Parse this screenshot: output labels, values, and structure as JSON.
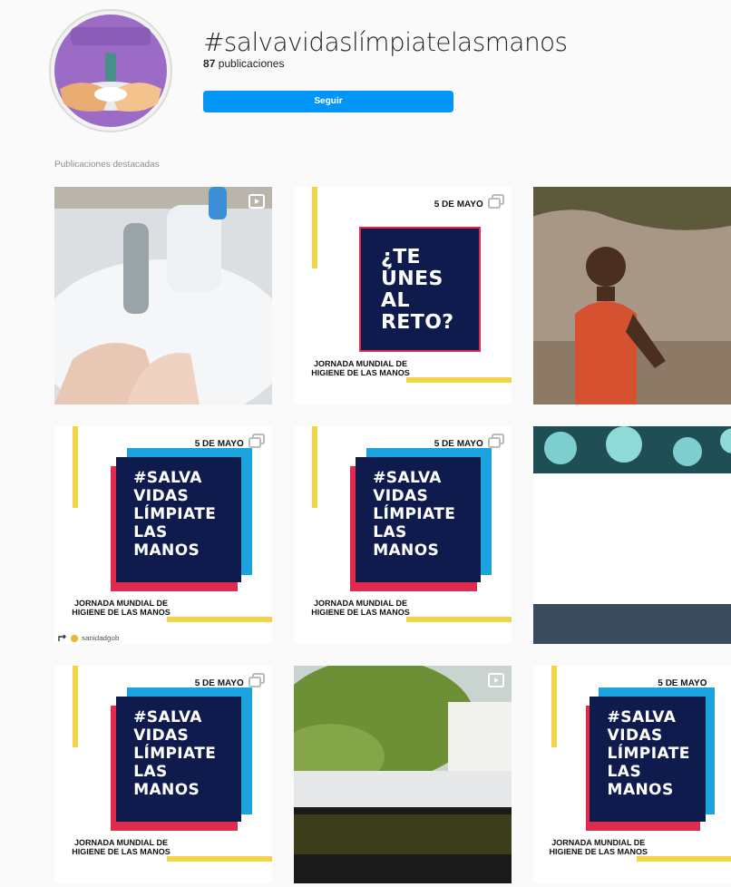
{
  "header": {
    "hashtag": "#salvavidaslímpiatelasmanos",
    "post_count": "**87** publicaciones",
    "follow_button": "Seguir"
  },
  "section_title": "Publicaciones destacadas",
  "posts": [
    {
      "kind": "video"
    },
    {
      "kind": "question-card",
      "date": "5 DE MAYO",
      "headline": "¿TE\nÚNES\nAL\nRETO?",
      "footer": "JORNADA MUNDIAL DE\nHIGIENE DE LAS MANOS",
      "multiple": true
    },
    {
      "kind": "picture"
    },
    {
      "kind": "slogan-card",
      "date": "5 DE MAYO",
      "headline": "#SALVA\nVIDAS\nLÍMPIATE\nLAS\nMANOS",
      "footer": "JORNADA MUNDIAL DE\nHIGIENE DE LAS MANOS",
      "multiple": true,
      "credit": "sanidadgob"
    },
    {
      "kind": "slogan-card",
      "date": "5 DE MAYO",
      "headline": "#SALVA\nVIDAS\nLÍMPIATE\nLAS\nMANOS",
      "footer": "JORNADA MUNDIAL DE\nHIGIENE DE LAS MANOS",
      "multiple": true
    },
    {
      "kind": "picture"
    },
    {
      "kind": "slogan-card",
      "date": "5 DE MAYO",
      "headline": "#SALVA\nVIDAS\nLÍMPIATE\nLAS\nMANOS",
      "footer": "JORNADA MUNDIAL DE\nHIGIENE DE LAS MANOS",
      "multiple": true
    },
    {
      "kind": "video"
    },
    {
      "kind": "slogan-card",
      "date": "5 DE MAYO",
      "headline": "#SALVA\nVIDAS\nLÍMPIATE\nLAS\nMANOS",
      "footer": "JORNADA MUNDIAL DE\nHIGIENE DE LAS MANOS",
      "multiple": false
    }
  ]
}
